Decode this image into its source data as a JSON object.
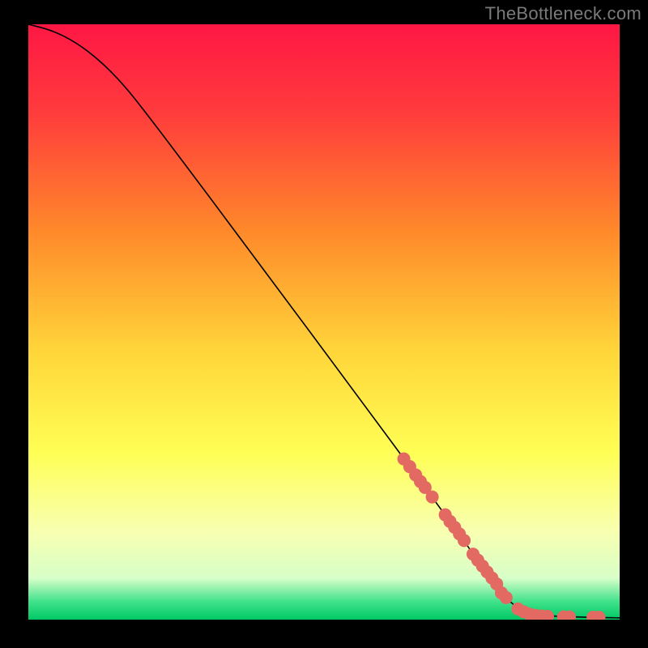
{
  "attribution": "TheBottleneck.com",
  "chart_data": {
    "type": "line",
    "xlabel": "",
    "ylabel": "",
    "xlim": [
      0,
      100
    ],
    "ylim": [
      0,
      100
    ],
    "title": "",
    "gradient_stops": [
      {
        "offset": 0.0,
        "color": "#ff1744"
      },
      {
        "offset": 0.15,
        "color": "#ff3c3c"
      },
      {
        "offset": 0.35,
        "color": "#ff8a2a"
      },
      {
        "offset": 0.55,
        "color": "#ffd63a"
      },
      {
        "offset": 0.72,
        "color": "#ffff55"
      },
      {
        "offset": 0.85,
        "color": "#f8ffb0"
      },
      {
        "offset": 0.93,
        "color": "#d8ffc8"
      },
      {
        "offset": 0.97,
        "color": "#3fe28b"
      },
      {
        "offset": 1.0,
        "color": "#00c864"
      }
    ],
    "curve": [
      {
        "x": 0,
        "y": 100
      },
      {
        "x": 4,
        "y": 99
      },
      {
        "x": 8,
        "y": 97
      },
      {
        "x": 12,
        "y": 94
      },
      {
        "x": 16,
        "y": 90
      },
      {
        "x": 20,
        "y": 85
      },
      {
        "x": 28,
        "y": 74.5
      },
      {
        "x": 40,
        "y": 58.5
      },
      {
        "x": 55,
        "y": 38.5
      },
      {
        "x": 68,
        "y": 21
      },
      {
        "x": 76,
        "y": 10
      },
      {
        "x": 80,
        "y": 4.5
      },
      {
        "x": 82,
        "y": 2.5
      },
      {
        "x": 84,
        "y": 1.2
      },
      {
        "x": 88,
        "y": 0.6
      },
      {
        "x": 94,
        "y": 0.4
      },
      {
        "x": 100,
        "y": 0.3
      }
    ],
    "markers": [
      {
        "x": 63.5,
        "y": 27.0
      },
      {
        "x": 64.5,
        "y": 25.7
      },
      {
        "x": 65.5,
        "y": 24.3
      },
      {
        "x": 66.3,
        "y": 23.2
      },
      {
        "x": 67.1,
        "y": 22.2
      },
      {
        "x": 68.3,
        "y": 20.6
      },
      {
        "x": 70.5,
        "y": 17.6
      },
      {
        "x": 71.3,
        "y": 16.5
      },
      {
        "x": 72.1,
        "y": 15.5
      },
      {
        "x": 72.9,
        "y": 14.4
      },
      {
        "x": 73.7,
        "y": 13.3
      },
      {
        "x": 75.2,
        "y": 11.0
      },
      {
        "x": 76.0,
        "y": 10.0
      },
      {
        "x": 76.8,
        "y": 9.0
      },
      {
        "x": 77.6,
        "y": 8.0
      },
      {
        "x": 78.4,
        "y": 7.0
      },
      {
        "x": 79.2,
        "y": 6.0
      },
      {
        "x": 80.0,
        "y": 4.5
      },
      {
        "x": 80.8,
        "y": 3.7
      },
      {
        "x": 82.8,
        "y": 1.8
      },
      {
        "x": 83.8,
        "y": 1.3
      },
      {
        "x": 84.8,
        "y": 0.9
      },
      {
        "x": 85.8,
        "y": 0.7
      },
      {
        "x": 86.8,
        "y": 0.6
      },
      {
        "x": 87.8,
        "y": 0.55
      },
      {
        "x": 90.5,
        "y": 0.45
      },
      {
        "x": 91.5,
        "y": 0.45
      },
      {
        "x": 95.5,
        "y": 0.4
      },
      {
        "x": 96.5,
        "y": 0.4
      }
    ],
    "marker_style": {
      "fill": "#e26a63",
      "r": 1.1
    }
  }
}
